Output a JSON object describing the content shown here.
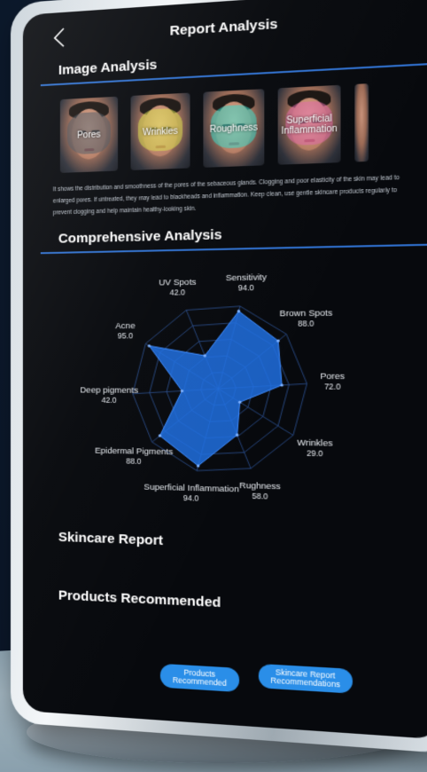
{
  "header": {
    "title": "Report Analysis"
  },
  "image_analysis": {
    "title": "Image Analysis",
    "images": [
      {
        "label": "Pores",
        "overlay_color": "#4a5660"
      },
      {
        "label": "Wrinkles",
        "overlay_color": "#d8dc4a"
      },
      {
        "label": "Roughness",
        "overlay_color": "#35d8c8"
      },
      {
        "label": "Superficial Inflammation",
        "overlay_color": "#e06aa8"
      }
    ],
    "description": "It shows the distribution and smoothness of the pores of the sebaceous glands. Clogging and poor elasticity of the skin may lead to enlarged pores. If untreated, they may lead to blackheads and inflammation. Keep clean, use gentle skincare products regularly to prevent clogging and help maintain healthy-looking skin."
  },
  "comprehensive": {
    "title": "Comprehensive Analysis"
  },
  "chart_data": {
    "type": "radar",
    "max": 100,
    "axes": [
      {
        "name": "Sensitivity",
        "value": 94.0
      },
      {
        "name": "Brown Spots",
        "value": 88.0
      },
      {
        "name": "Pores",
        "value": 72.0
      },
      {
        "name": "Wrinkles",
        "value": 29.0
      },
      {
        "name": "Rughness",
        "value": 58.0
      },
      {
        "name": "Superficial Inflammation",
        "value": 94.0
      },
      {
        "name": "Epidermal Pigments",
        "value": 88.0
      },
      {
        "name": "Deep pigments",
        "value": 42.0
      },
      {
        "name": "Acne",
        "value": 95.0
      },
      {
        "name": "UV Spots",
        "value": 42.0
      }
    ],
    "fill_color": "#1f6fe0",
    "grid_color": "#2b4f8f"
  },
  "skincare_report": {
    "title": "Skincare Report"
  },
  "products": {
    "title": "Products Recommended"
  },
  "buttons": {
    "products": "Products Recommended",
    "skincare": "Skincare Report Recommendations"
  },
  "colors": {
    "accent": "#2a8ee8",
    "rule": "#2f6fcc"
  }
}
